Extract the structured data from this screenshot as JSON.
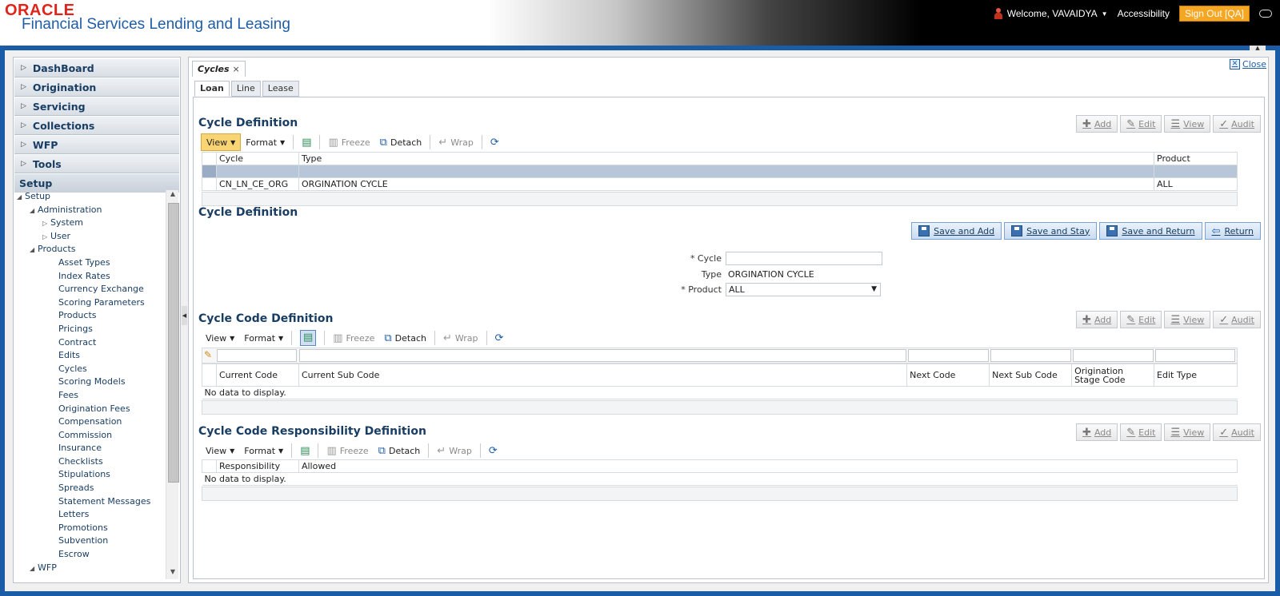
{
  "header": {
    "brand": "ORACLE",
    "app_name": "Financial Services Lending and Leasing",
    "welcome": "Welcome, VAVAIDYA",
    "accessibility": "Accessibility",
    "signout": "Sign Out [QA]"
  },
  "sidebar": {
    "items": [
      {
        "label": "DashBoard"
      },
      {
        "label": "Origination"
      },
      {
        "label": "Servicing"
      },
      {
        "label": "Collections"
      },
      {
        "label": "WFP"
      },
      {
        "label": "Tools"
      }
    ],
    "setup_label": "Setup",
    "tree": {
      "setup": "Setup",
      "administration": "Administration",
      "system": "System",
      "user": "User",
      "products": "Products",
      "product_children": [
        "Asset Types",
        "Index Rates",
        "Currency Exchange",
        "Scoring Parameters",
        "Products",
        "Pricings",
        "Contract",
        "Edits",
        "Cycles",
        "Scoring Models",
        "Fees",
        "Origination Fees",
        "Compensation",
        "Commission",
        "Insurance",
        "Checklists",
        "Stipulations",
        "Spreads",
        "Statement Messages",
        "Letters",
        "Promotions",
        "Subvention",
        "Escrow"
      ],
      "wfp": "WFP"
    }
  },
  "content": {
    "doc_tab": "Cycles",
    "close": "Close",
    "sub_tabs": [
      "Loan",
      "Line",
      "Lease"
    ]
  },
  "actions": {
    "add": "Add",
    "edit": "Edit",
    "view": "View",
    "audit": "Audit"
  },
  "toolbar": {
    "view": "View",
    "format": "Format",
    "freeze": "Freeze",
    "detach": "Detach",
    "wrap": "Wrap"
  },
  "cycle_def_grid": {
    "title": "Cycle Definition",
    "columns": [
      "Cycle",
      "Type",
      "Product"
    ],
    "rows": [
      {
        "cycle": "CN_LN_CE_ORG",
        "type": "ORGINATION CYCLE",
        "product": "ALL"
      }
    ]
  },
  "cycle_def_form": {
    "title": "Cycle Definition",
    "save_add": "Save and Add",
    "save_stay": "Save and Stay",
    "save_return": "Save and Return",
    "return": "Return",
    "cycle_label": "* Cycle",
    "cycle_value": "",
    "type_label": "Type",
    "type_value": "ORGINATION CYCLE",
    "product_label": "* Product",
    "product_value": "ALL"
  },
  "cycle_code_grid": {
    "title": "Cycle Code Definition",
    "columns": [
      "Current Code",
      "Current Sub Code",
      "Next Code",
      "Next Sub Code",
      "Origination Stage Code",
      "Edit Type"
    ],
    "empty": "No data to display."
  },
  "responsibility_grid": {
    "title": "Cycle Code Responsibility Definition",
    "columns": [
      "Responsibility",
      "Allowed"
    ],
    "empty": "No data to display."
  }
}
